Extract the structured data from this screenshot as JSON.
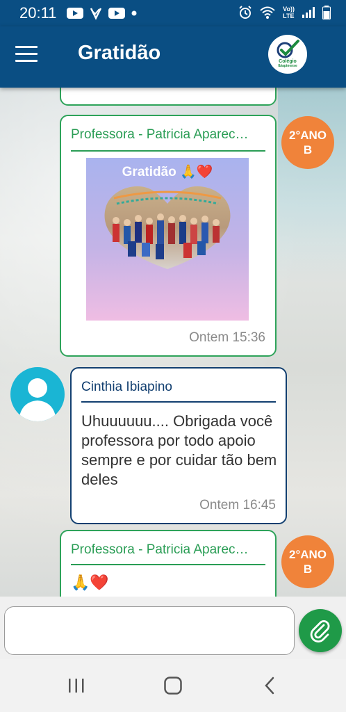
{
  "status_bar": {
    "time": "20:11",
    "left_icons": [
      "youtube-icon",
      "vpn-check-icon",
      "youtube-icon",
      "notification-dot-icon"
    ],
    "right_icons": [
      "alarm-icon",
      "wifi-icon",
      "volte-icon",
      "signal-icon",
      "battery-icon"
    ],
    "volte_text_top": "Vo))",
    "volte_text_bottom": "LTE"
  },
  "app_bar": {
    "title": "Gratidão",
    "menu_icon": "hamburger-menu-icon",
    "logo_text_top": "Colégio",
    "logo_text_bottom": "Ibiapinense"
  },
  "messages": [
    {
      "author": "Professora - Patricia Aparec…",
      "image_caption": "Gratidão 🙏❤️",
      "time": "Ontem 15:36",
      "badge": {
        "line1": "2°ANO",
        "line2": "B"
      }
    },
    {
      "author": "Cinthia Ibiapino",
      "text": "Uhuuuuuu.... Obrigada você professora  por todo apoio sempre e por cuidar tão bem deles",
      "time": "Ontem 16:45",
      "avatar_icon": "person-avatar-icon"
    },
    {
      "author": "Professora - Patricia Aparec…",
      "text": "🙏❤️",
      "badge": {
        "line1": "2°ANO",
        "line2": "B"
      }
    }
  ],
  "composer": {
    "placeholder": "",
    "attach_icon": "paperclip-icon"
  },
  "nav_bar": {
    "icons": [
      "recent-apps-icon",
      "home-icon",
      "back-icon"
    ]
  },
  "colors": {
    "app_bar": "#0a4e83",
    "teacher_border": "#2ea35a",
    "parent_border": "#123f70",
    "badge": "#f0833a",
    "attach_button": "#1f9a48",
    "avatar": "#1ab5d4"
  }
}
